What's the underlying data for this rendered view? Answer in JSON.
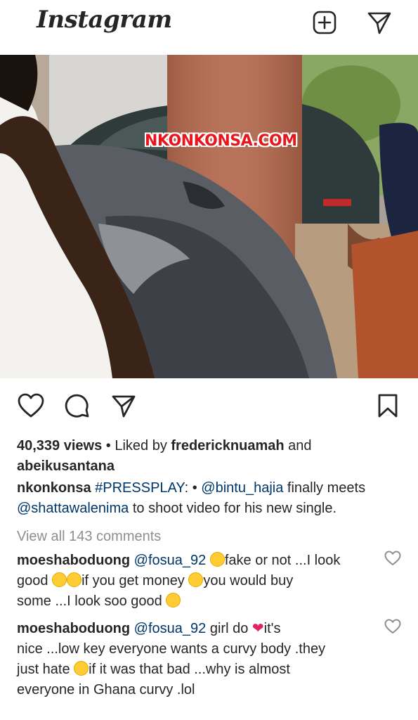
{
  "app": {
    "logo": "Instagram"
  },
  "header": {
    "icons": [
      "new-post-icon",
      "direct-message-icon"
    ]
  },
  "media": {
    "watermark": "NKONKONSA.COM"
  },
  "post": {
    "views": "40,339 views",
    "liked_by_prefix": " • Liked by ",
    "liked_user_1": "fredericknuamah",
    "and": " and",
    "liked_user_2": "abeikusantana",
    "caption_user": "nkonkonsa",
    "caption_hashtag": "#PRESSPLAY",
    "caption_sep": ": • ",
    "caption_mention_1": "@bintu_hajia",
    "caption_mid": " finally meets",
    "caption_mention_2": "@shattawalenima",
    "caption_end": " to shoot video for his new single.",
    "view_comments": "View all 143 comments"
  },
  "comments": [
    {
      "user": "moeshaboduong",
      "mention": "@fosua_92",
      "t1": "fake or not ...I look",
      "t2": "good ",
      "t3": "if you get money ",
      "t4": "you would buy",
      "t5": "some ...I look soo good "
    },
    {
      "user": "moeshaboduong",
      "mention": "@fosua_92",
      "t1": " girl do ",
      "t2": "it's",
      "t3": "nice ...low key everyone wants a curvy body .they",
      "t4": "just hate ",
      "t5": "if it was that bad ...why is almost",
      "t6": "everyone in Ghana curvy .lol"
    }
  ],
  "colors": {
    "text": "#262626",
    "link": "#00376b",
    "muted": "#8e8e8e",
    "watermark": "#e9151d",
    "heart_emoji": "#e0245e"
  }
}
